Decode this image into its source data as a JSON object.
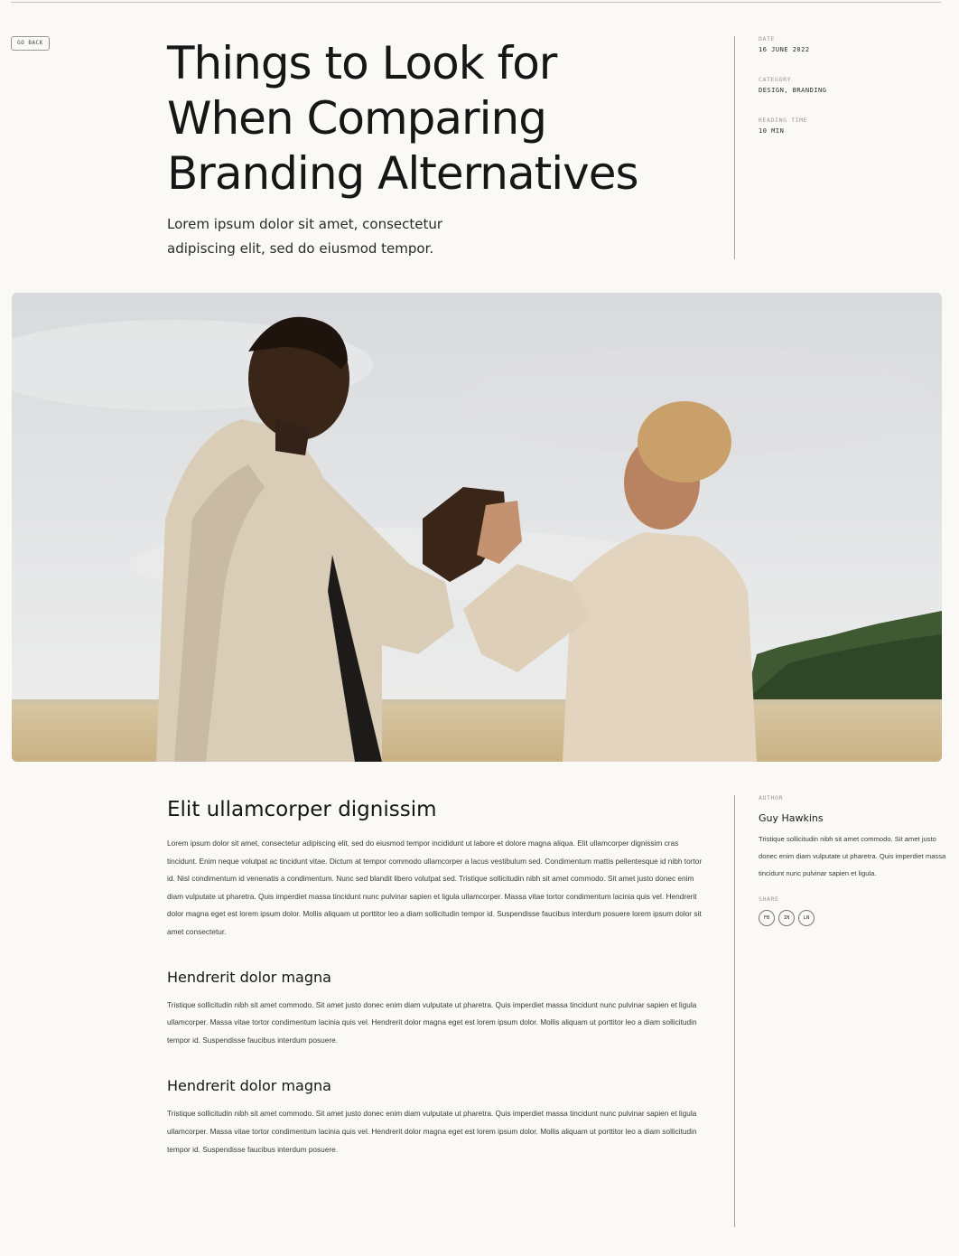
{
  "nav": {
    "back_label": "GO BACK"
  },
  "hero": {
    "title_lines": [
      "Things to Look for",
      "When Comparing",
      "Branding Alternatives"
    ],
    "subtitle_lines": [
      "Lorem ipsum dolor sit amet, consectetur",
      "adipiscing elit, sed do eiusmod tempor."
    ]
  },
  "meta": {
    "date_label": "DATE",
    "date_value": "16 JUNE 2022",
    "category_label": "CATEGORY",
    "category_value": "DESIGN, BRANDING",
    "reading_label": "READING TIME",
    "reading_value": "10 MIN"
  },
  "article": {
    "section_title": "Elit ullamcorper dignissim",
    "intro": "Lorem ipsum dolor sit amet, consectetur adipiscing elit, sed do eiusmod tempor incididunt ut labore et dolore magna aliqua. Elit ullamcorper dignissim cras tincidunt. Enim neque volutpat ac tincidunt vitae. Dictum at tempor commodo ullamcorper a lacus vestibulum sed. Condimentum mattis pellentesque id nibh tortor id. Nisl condimentum id venenatis a condimentum. Nunc sed blandit libero volutpat sed. Tristique sollicitudin nibh sit amet commodo. Sit amet justo donec enim diam vulputate ut pharetra. Quis imperdiet massa tincidunt nunc pulvinar sapien et ligula ullamcorper. Massa vitae tortor condimentum lacinia quis vel. Hendrerit dolor magna eget est lorem ipsum dolor. Mollis aliquam ut porttitor leo a diam sollicitudin tempor id. Suspendisse faucibus interdum posuere lorem ipsum dolor sit amet consectetur.",
    "sub1_title": "Hendrerit dolor magna",
    "sub1_body": "Tristique sollicitudin nibh sit amet commodo. Sit amet justo donec enim diam vulputate ut pharetra. Quis imperdiet massa tincidunt nunc pulvinar sapien et ligula ullamcorper. Massa vitae tortor condimentum lacinia quis vel. Hendrerit dolor magna eget est lorem ipsum dolor. Mollis aliquam ut porttitor leo a diam sollicitudin tempor id. Suspendisse faucibus interdum posuere.",
    "sub2_title": "Hendrerit dolor magna",
    "sub2_body": "Tristique sollicitudin nibh sit amet commodo. Sit amet justo donec enim diam vulputate ut pharetra. Quis imperdiet massa tincidunt nunc pulvinar sapien et ligula ullamcorper. Massa vitae tortor condimentum lacinia quis vel. Hendrerit dolor magna eget est lorem ipsum dolor. Mollis aliquam ut porttitor leo a diam sollicitudin tempor id. Suspendisse faucibus interdum posuere."
  },
  "author": {
    "label": "AUTHOR",
    "name": "Guy Hawkins",
    "bio": "Tristique sollicitudin nibh sit amet commodo. Sit amet justo donec enim diam vulputate ut pharetra. Quis imperdiet massa tincidunt nunc pulvinar sapien et ligula.",
    "share_label": "SHARE",
    "share_buttons": [
      "FB",
      "IN",
      "LN"
    ]
  }
}
